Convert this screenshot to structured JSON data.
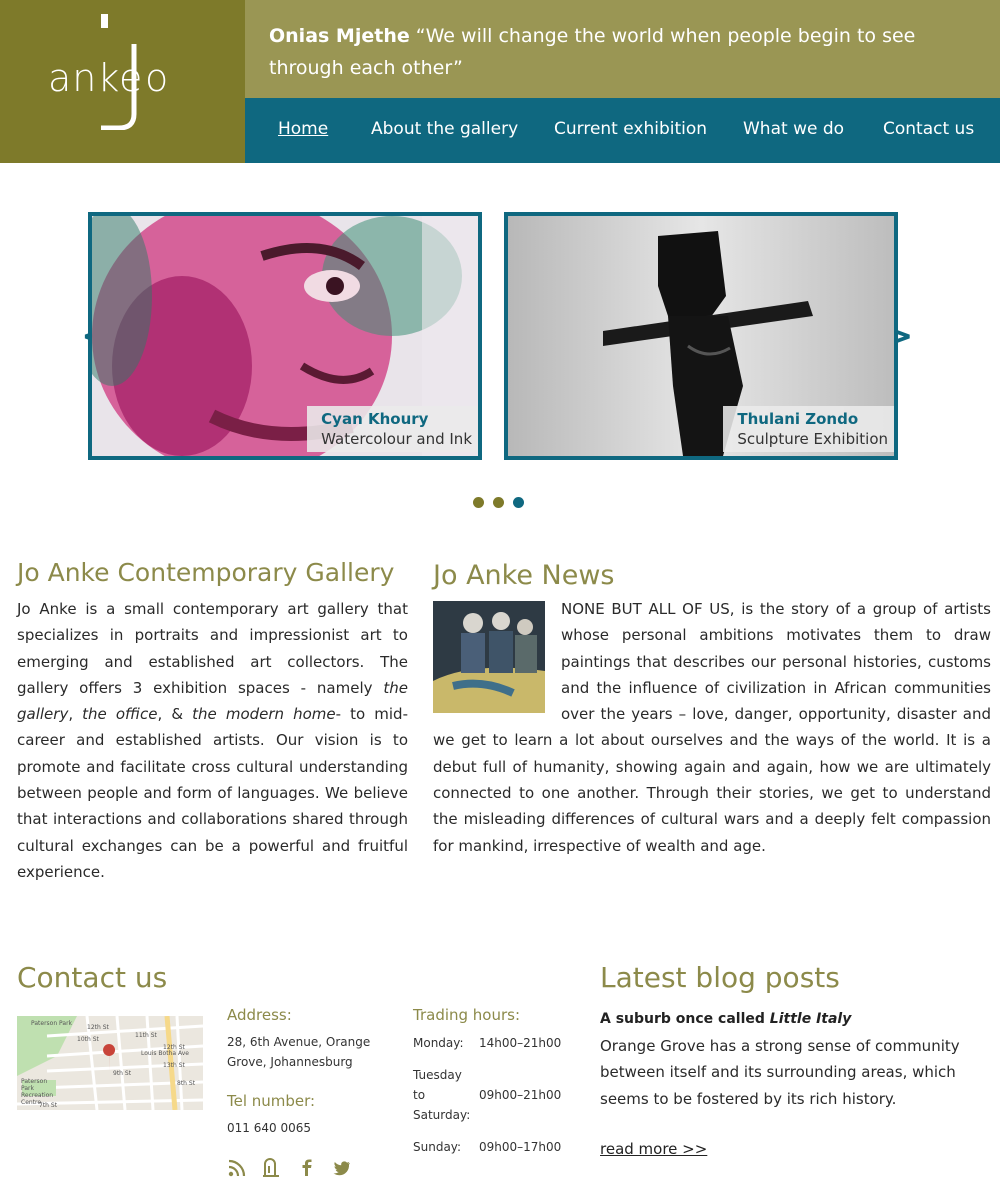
{
  "logo": {
    "text": "anke",
    "letter_o": "o"
  },
  "header": {
    "quote_author": "Onias Mjethe",
    "quote_text": " “We will change the world when people begin to see through each other”"
  },
  "nav": {
    "items": [
      {
        "label": "Home",
        "active": true
      },
      {
        "label": "About the gallery"
      },
      {
        "label": "Current exhibition"
      },
      {
        "label": "What we do"
      },
      {
        "label": "Contact us"
      }
    ]
  },
  "slider": {
    "prev": "<",
    "next": ">",
    "slides": [
      {
        "name": "Cyan Khoury",
        "subtitle": "Watercolour and Ink"
      },
      {
        "name": "Thulani Zondo",
        "subtitle": "Sculpture Exhibition"
      }
    ],
    "dots": 3,
    "active_dot": 3
  },
  "gallery": {
    "title": "Jo Anke Contemporary Gallery",
    "p1": "Jo Anke is a small contemporary art gallery that specializes in portraits and impressionist art to emerging and established art collectors. The gallery offers 3 exhibition spaces - namely ",
    "em1": "the gallery",
    "sep1": ", ",
    "em2": "the office",
    "sep2": ", & ",
    "em3": "the modern home",
    "p2": "- to mid-career and established artists. Our vision is to promote and facilitate cross cultural understanding between people and form of languages. We believe that interactions and collaborations shared through cultural exchanges can be a powerful and fruitful experience."
  },
  "news": {
    "title": "Jo Anke News",
    "body": "NONE BUT ALL OF US, is the story of a group of artists whose personal ambitions motivates them to draw paintings that describes our personal histories, customs and the influence of civilization in African communities over the years – love, danger, opportunity, disaster and we get to learn a lot about ourselves and the ways of the world. It is a debut full of humanity, showing again and again, how we are ultimately connected to one another. Through their stories, we get to understand the misleading differences of cultural wars and a deeply felt compassion for mankind, irrespective of wealth and age."
  },
  "contact": {
    "title": "Contact us",
    "address_label": "Address:",
    "address": "28, 6th Avenue, Orange Grove, Johannesburg",
    "tel_label": "Tel number:",
    "tel": "011 640 0065",
    "hours_label": "Trading hours:",
    "hours": [
      {
        "day": "Monday:",
        "time": "14h00–21h00"
      },
      {
        "day": "Tuesday to Saturday:",
        "time": "09h00–21h00"
      },
      {
        "day": "Sunday:",
        "time": "09h00–17h00"
      }
    ],
    "map_labels": [
      "Paterson Park",
      "12th St",
      "10th St",
      "11th St",
      "12th St",
      "13th St",
      "9th St",
      "8th St",
      "Louis Botha Ave",
      "Paterson Park Recreation Centre",
      "7th St"
    ],
    "social_icons": [
      "rss-icon",
      "mobile-icon",
      "facebook-icon",
      "twitter-icon"
    ]
  },
  "blog": {
    "title": "Latest blog posts",
    "post_title_prefix": "A suburb once called ",
    "post_title_em": "Little Italy",
    "excerpt": "Orange Grove has a strong sense of community between itself and its surrounding areas, which seems to be fostered by its rich history.",
    "read_more": "read more >>"
  },
  "colors": {
    "olive_dark": "#7e7a2a",
    "olive": "#9a9654",
    "teal": "#0f6880",
    "heading": "#8c8a4a"
  }
}
